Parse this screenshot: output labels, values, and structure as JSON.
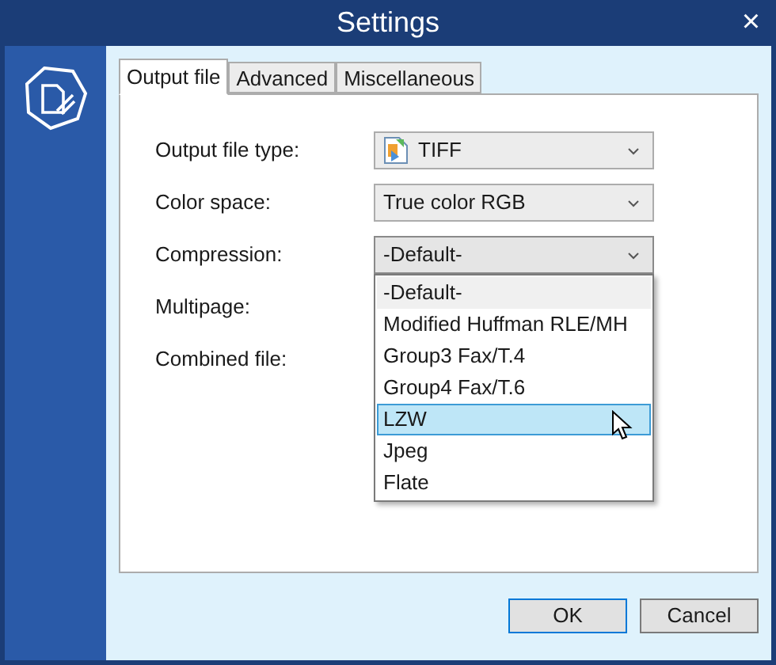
{
  "window": {
    "title": "Settings",
    "close": "×"
  },
  "tabs": [
    {
      "label": "Output file",
      "selected": true
    },
    {
      "label": "Advanced",
      "selected": false
    },
    {
      "label": "Miscellaneous",
      "selected": false
    }
  ],
  "fields": [
    {
      "label": "Output file type:",
      "kind": "select",
      "value": "TIFF",
      "file_icon": true
    },
    {
      "label": "Color space:",
      "kind": "select",
      "value": "True color RGB"
    },
    {
      "label": "Compression:",
      "kind": "select",
      "value": "-Default-",
      "expanded": true
    },
    {
      "label": "Multipage:",
      "kind": "none"
    },
    {
      "label": "Combined file:",
      "kind": "none"
    }
  ],
  "dropdown_options": [
    {
      "label": "-Default-",
      "selected": true,
      "hovered": false
    },
    {
      "label": "Modified Huffman RLE/MH",
      "selected": false,
      "hovered": false
    },
    {
      "label": "Group3 Fax/T.4",
      "selected": false,
      "hovered": false
    },
    {
      "label": "Group4 Fax/T.6",
      "selected": false,
      "hovered": false
    },
    {
      "label": "LZW",
      "selected": false,
      "hovered": true
    },
    {
      "label": "Jpeg",
      "selected": false,
      "hovered": false
    },
    {
      "label": "Flate",
      "selected": false,
      "hovered": false
    }
  ],
  "buttons": [
    {
      "label": "OK",
      "default": true
    },
    {
      "label": "Cancel",
      "default": false
    }
  ]
}
